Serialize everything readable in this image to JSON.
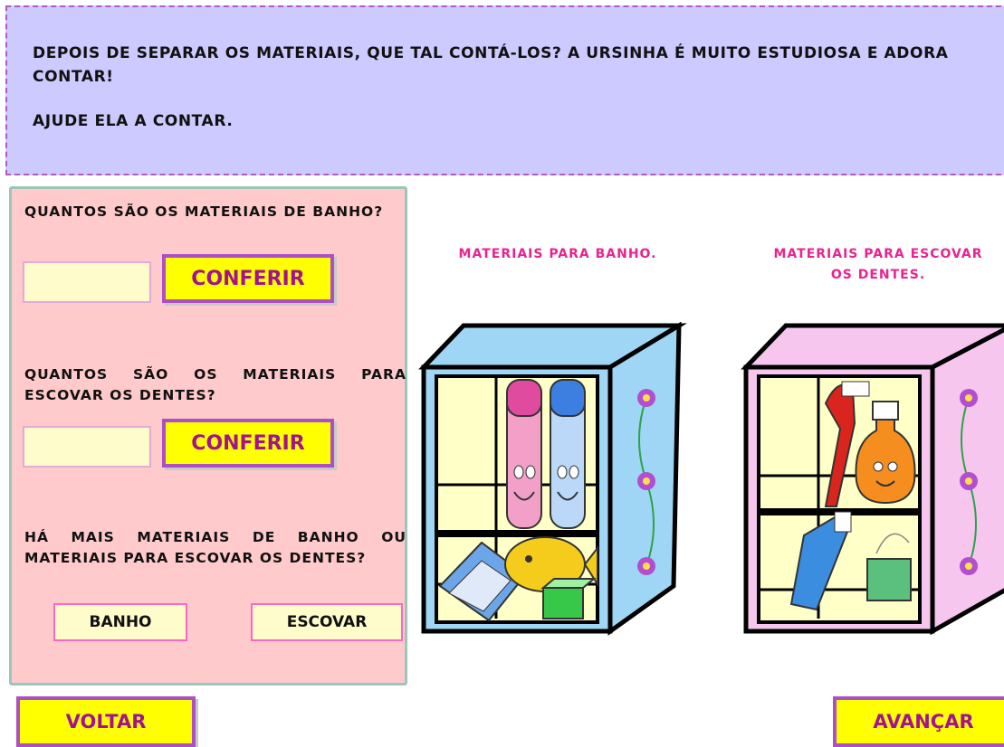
{
  "header": {
    "line1": "DEPOIS DE SEPARAR OS MATERIAIS, QUE TAL CONTÁ-LOS? A URSINHA É MUITO ESTUDIOSA E ADORA CONTAR!",
    "line2": "AJUDE ELA A CONTAR."
  },
  "panel": {
    "q1": "QUANTOS SÃO OS MATERIAIS DE BANHO?",
    "q2": "QUANTOS SÃO OS MATERIAIS PARA ESCOVAR OS DENTES?",
    "q3": "HÁ MAIS MATERIAIS DE BANHO OU MATERIAIS PARA ESCOVAR OS DENTES?",
    "answer1_value": "",
    "answer2_value": "",
    "conferir_label": "CONFERIR",
    "banho_label": "BANHO",
    "escovar_label": "ESCOVAR"
  },
  "cabinets": {
    "bath_title": "MATERIAIS PARA BANHO.",
    "teeth_title": "MATERIAIS PARA ESCOVAR OS DENTES."
  },
  "nav": {
    "back_label": "VOLTAR",
    "next_label": "AVANÇAR"
  },
  "colors": {
    "header_bg": "#cccaff",
    "panel_bg": "#ffcacb",
    "button_yellow": "#ffff00",
    "button_text": "#a3138f",
    "title_pink": "#e9238f",
    "bath_cabinet": "#9fd6f5",
    "teeth_cabinet": "#f6c6ee"
  }
}
